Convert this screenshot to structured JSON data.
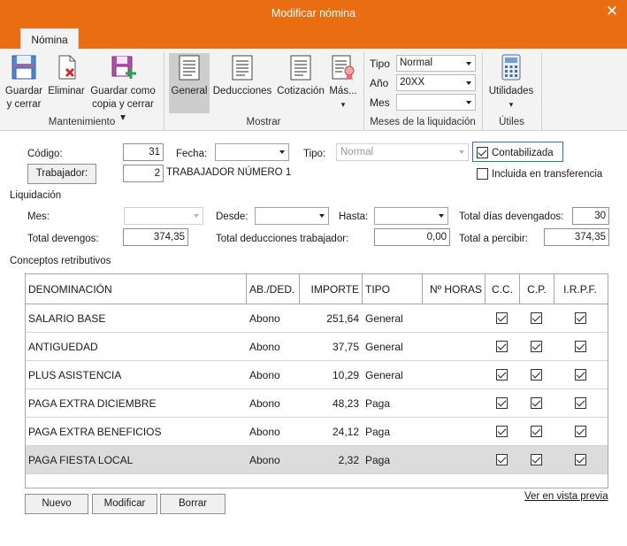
{
  "window": {
    "title": "Modificar nómina",
    "close_glyph": "✕"
  },
  "tabs": [
    {
      "label": "Nómina",
      "active": true
    }
  ],
  "ribbon": {
    "mantenimiento": {
      "label": "Mantenimiento",
      "guardar_cerrar": {
        "line1": "Guardar",
        "line2": "y cerrar",
        "icon": "save-close-icon"
      },
      "eliminar": {
        "line1": "Eliminar",
        "icon": "delete-icon"
      },
      "guardar_copia": {
        "line1": "Guardar como",
        "line2": "copia y cerrar ▾",
        "icon": "save-copy-icon"
      }
    },
    "mostrar": {
      "label": "Mostrar",
      "general": {
        "label": "General",
        "icon": "document-icon",
        "selected": true
      },
      "deducciones": {
        "label": "Deducciones",
        "icon": "document-icon"
      },
      "cotizacion": {
        "label": "Cotización",
        "icon": "document-icon"
      },
      "mas": {
        "label": "Más...",
        "icon": "document-badge-icon"
      }
    },
    "meses": {
      "label": "Meses de la liquidación",
      "tipo": {
        "label": "Tipo",
        "value": "Normal"
      },
      "anio": {
        "label": "Año",
        "value": "20XX"
      },
      "mes": {
        "label": "Mes",
        "value": ""
      }
    },
    "utiles": {
      "label": "Útiles",
      "utilidades": {
        "label": "Utilidades",
        "icon": "calculator-icon"
      }
    }
  },
  "form": {
    "codigo": {
      "label": "Código:",
      "value": "31"
    },
    "fecha": {
      "label": "Fecha:",
      "value": ""
    },
    "tipo": {
      "label": "Tipo:",
      "value": "Normal"
    },
    "contabilizada": {
      "label": "Contabilizada",
      "checked": true
    },
    "trabajador": {
      "button": "Trabajador:",
      "code": "2",
      "name": "TRABAJADOR NÚMERO 1"
    },
    "incluida": {
      "label": "Incluida en transferencia",
      "checked": false
    }
  },
  "liquidacion": {
    "title": "Liquidación",
    "mes": {
      "label": "Mes:",
      "value": ""
    },
    "desde": {
      "label": "Desde:",
      "value": ""
    },
    "hasta": {
      "label": "Hasta:",
      "value": ""
    },
    "total_dias": {
      "label": "Total días devengados:",
      "value": "30"
    },
    "total_devengos": {
      "label": "Total devengos:",
      "value": "374,35"
    },
    "total_deducciones": {
      "label": "Total deducciones trabajador:",
      "value": "0,00"
    },
    "total_percibir": {
      "label": "Total a percibir:",
      "value": "374,35"
    }
  },
  "conceptos": {
    "title": "Conceptos retributivos",
    "columns": [
      "DENOMINACIÓN",
      "AB./DED.",
      "IMPORTE",
      "TIPO",
      "Nº HORAS",
      "C.C.",
      "C.P.",
      "I.R.P.F."
    ],
    "rows": [
      {
        "denominacion": "SALARIO BASE",
        "ab_ded": "Abono",
        "importe": "251,64",
        "tipo": "General",
        "horas": "",
        "cc": true,
        "cp": true,
        "irpf": true
      },
      {
        "denominacion": "ANTIGUEDAD",
        "ab_ded": "Abono",
        "importe": "37,75",
        "tipo": "General",
        "horas": "",
        "cc": true,
        "cp": true,
        "irpf": true
      },
      {
        "denominacion": "PLUS ASISTENCIA",
        "ab_ded": "Abono",
        "importe": "10,29",
        "tipo": "General",
        "horas": "",
        "cc": true,
        "cp": true,
        "irpf": true
      },
      {
        "denominacion": "PAGA EXTRA DICIEMBRE",
        "ab_ded": "Abono",
        "importe": "48,23",
        "tipo": "Paga",
        "horas": "",
        "cc": true,
        "cp": true,
        "irpf": true
      },
      {
        "denominacion": "PAGA EXTRA BENEFICIOS",
        "ab_ded": "Abono",
        "importe": "24,12",
        "tipo": "Paga",
        "horas": "",
        "cc": true,
        "cp": true,
        "irpf": true
      },
      {
        "denominacion": "PAGA FIESTA LOCAL",
        "ab_ded": "Abono",
        "importe": "2,32",
        "tipo": "Paga",
        "horas": "",
        "cc": true,
        "cp": true,
        "irpf": true,
        "selected": true
      }
    ]
  },
  "footer": {
    "nuevo": "Nuevo",
    "modificar": "Modificar",
    "borrar": "Borrar",
    "vista_previa": "Ver en vista previa"
  },
  "colors": {
    "accent": "#ea6d11",
    "focus": "#2b74c9",
    "ribbon": "#f3f3f3",
    "selected_row": "#dcdcdc"
  }
}
